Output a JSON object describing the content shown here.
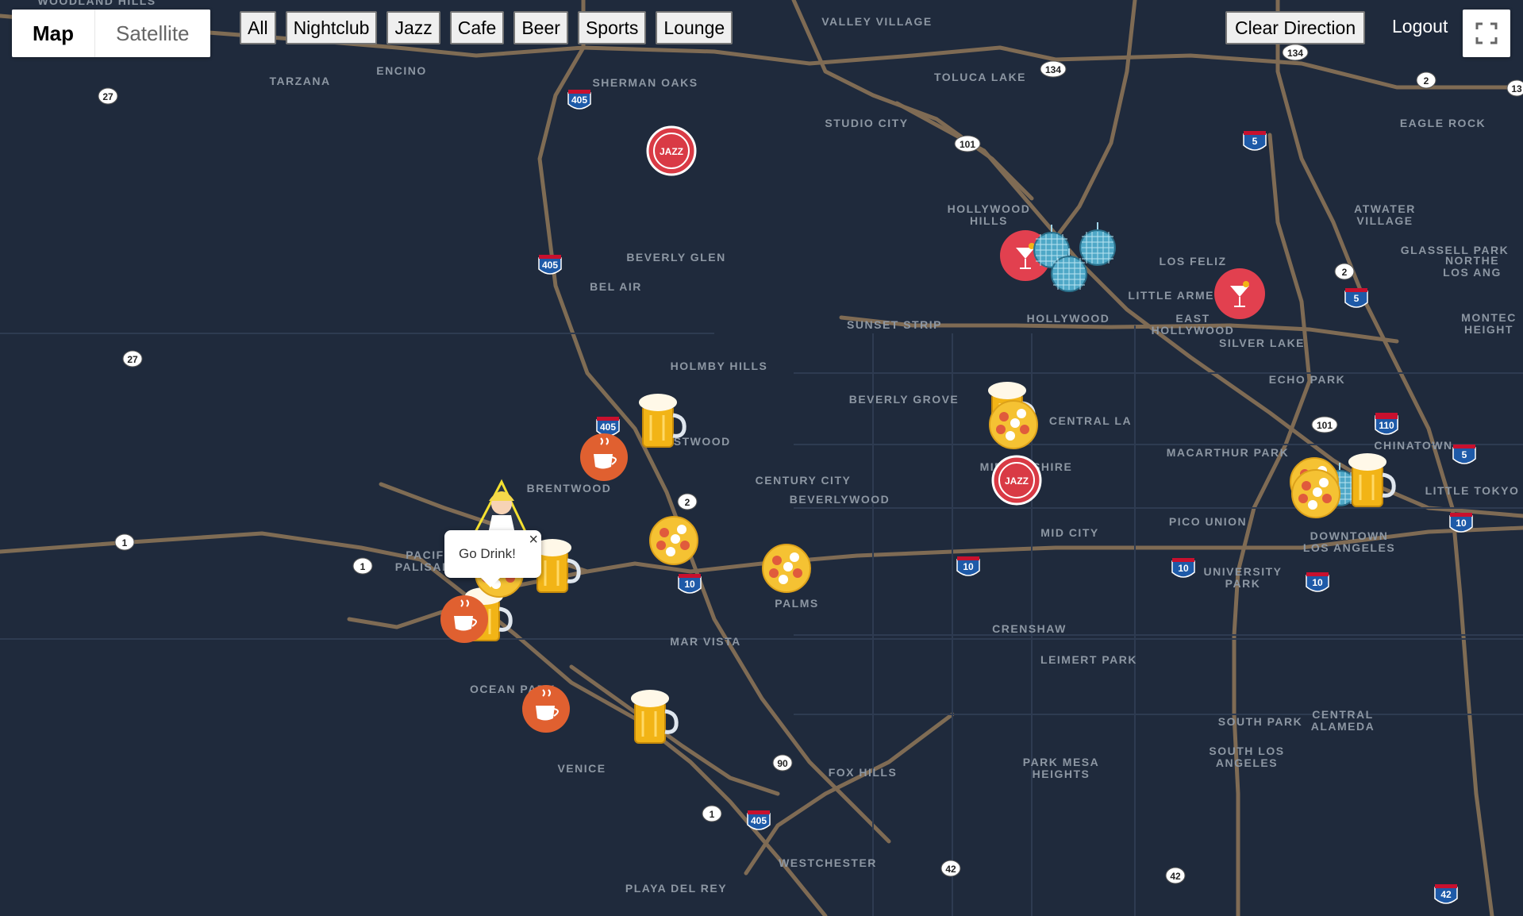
{
  "map_type": {
    "map_label": "Map",
    "satellite_label": "Satellite"
  },
  "filters": [
    "All",
    "Nightclub",
    "Jazz",
    "Cafe",
    "Beer",
    "Sports",
    "Lounge"
  ],
  "clear_direction_label": "Clear Direction",
  "logout_label": "Logout",
  "popup": {
    "text": "Go Drink!",
    "close": "×"
  },
  "colors": {
    "map_background": "#1f2a3c",
    "road": "#8a7357",
    "label": "#8d97a3",
    "cafe": "#e06030",
    "jazz": "#d93a45",
    "lounge": "#e2404f",
    "beer": "#f2b416",
    "sports": "#f5c233",
    "nightclub": "#4fa8c7"
  },
  "place_labels": [
    "VALLEY VILLAGE",
    "TOLUCA LAKE",
    "TARZANA",
    "ENCINO",
    "SHERMAN OAKS",
    "STUDIO CITY",
    "EAGLE ROCK",
    "HOLLYWOOD HILLS",
    "ATWATER VILLAGE",
    "GLASSELL PARK",
    "BEVERLY GLEN",
    "BEL AIR",
    "LOS FELIZ",
    "LITTLE ARMENIA",
    "HOLLYWOOD",
    "EAST HOLLYWOOD",
    "SILVER LAKE",
    "NORTHEAST LOS ANGELES",
    "MONTECITO HEIGHTS",
    "SUNSET STRIP",
    "HOLMBY HILLS",
    "BEVERLY GROVE",
    "CENTRAL LA",
    "ECHO PARK",
    "WESTWOOD",
    "CHINATOWN",
    "MACARTHUR PARK",
    "MID-WILSHIRE",
    "BRENTWOOD",
    "CENTURY CITY",
    "BEVERLYWOOD",
    "LITTLE TOKYO",
    "PICO UNION",
    "DOWNTOWN LOS ANGELES",
    "MID CITY",
    "PACIFIC PALISADES",
    "UNIVERSITY PARK",
    "PALMS",
    "MAR VISTA",
    "CRENSHAW",
    "LEIMERT PARK",
    "OCEAN PARK",
    "SOUTH PARK",
    "CENTRAL ALAMEDA",
    "SOUTH LOS ANGELES",
    "VENICE",
    "PARK MESA HEIGHTS",
    "FOX HILLS",
    "WESTCHESTER",
    "PLAYA DEL REY",
    "WOODLAND HILLS"
  ],
  "route_shields": [
    "405",
    "405",
    "405",
    "405",
    "27",
    "27",
    "1",
    "1",
    "1",
    "2",
    "2",
    "2",
    "10",
    "10",
    "10",
    "10",
    "10",
    "101",
    "101",
    "110",
    "110",
    "134",
    "134",
    "5",
    "5",
    "5",
    "90",
    "42",
    "42",
    "42",
    "13"
  ],
  "markers": [
    {
      "type": "jazz"
    },
    {
      "type": "jazz"
    },
    {
      "type": "lounge"
    },
    {
      "type": "lounge"
    },
    {
      "type": "nightclub"
    },
    {
      "type": "nightclub"
    },
    {
      "type": "nightclub"
    },
    {
      "type": "nightclub"
    },
    {
      "type": "beer"
    },
    {
      "type": "beer"
    },
    {
      "type": "beer"
    },
    {
      "type": "beer"
    },
    {
      "type": "beer"
    },
    {
      "type": "beer"
    },
    {
      "type": "cafe"
    },
    {
      "type": "cafe"
    },
    {
      "type": "cafe"
    },
    {
      "type": "sports"
    },
    {
      "type": "sports"
    },
    {
      "type": "sports"
    },
    {
      "type": "sports"
    },
    {
      "type": "sports"
    },
    {
      "type": "sports"
    },
    {
      "type": "user-location"
    }
  ]
}
